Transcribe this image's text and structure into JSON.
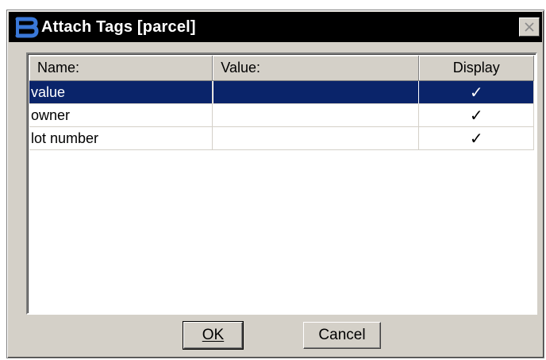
{
  "window": {
    "title": "Attach Tags [parcel]",
    "icon": "bentley-b-icon",
    "close_icon": "close-icon"
  },
  "table": {
    "headers": {
      "name": "Name:",
      "value": "Value:",
      "display": "Display"
    },
    "rows": [
      {
        "name": "value",
        "value": "",
        "display": "✓",
        "selected": true
      },
      {
        "name": "owner",
        "value": "",
        "display": "✓",
        "selected": false
      },
      {
        "name": "lot number",
        "value": "",
        "display": "✓",
        "selected": false
      }
    ]
  },
  "buttons": {
    "ok": "OK",
    "cancel": "Cancel"
  },
  "colors": {
    "selection": "#0a246a",
    "face": "#d4d0c8",
    "titlebar": "#000000"
  }
}
